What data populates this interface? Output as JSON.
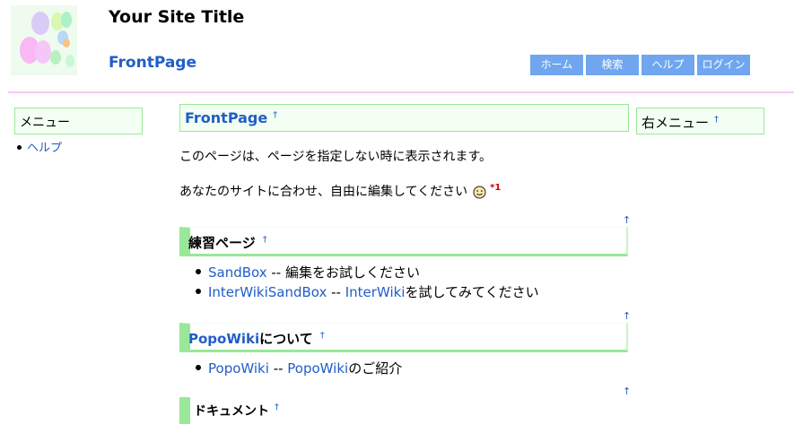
{
  "header": {
    "site_title": "Your Site Title",
    "page_name": "FrontPage",
    "nav": [
      {
        "label": "ホーム"
      },
      {
        "label": "検索"
      },
      {
        "label": "ヘルプ"
      },
      {
        "label": "ログイン"
      }
    ]
  },
  "left_menu": {
    "title": "メニュー",
    "items": [
      {
        "label": "ヘルプ"
      }
    ]
  },
  "right_menu": {
    "title": "右メニュー",
    "anchor": "†"
  },
  "main": {
    "title": "FrontPage",
    "anchor": "†",
    "top_link": "↑",
    "para1": "このページは、ページを指定しない時に表示されます。",
    "para2": "あなたのサイトに合わせ、自由に編集してください",
    "footnote_ref": "*1",
    "sections": [
      {
        "heading": "練習ページ",
        "items": [
          {
            "link": "SandBox",
            "text": " -- 編集をお試しください"
          },
          {
            "link": "InterWikiSandBox",
            "text": " -- ",
            "link2": "InterWiki",
            "text2": "を試してみてください"
          }
        ]
      },
      {
        "heading_link": "PopoWiki",
        "heading": "について",
        "items": [
          {
            "link": "PopoWiki",
            "text": " -- ",
            "link2": "PopoWiki",
            "text2": "のご紹介"
          }
        ]
      },
      {
        "heading": "ドキュメント"
      }
    ]
  }
}
